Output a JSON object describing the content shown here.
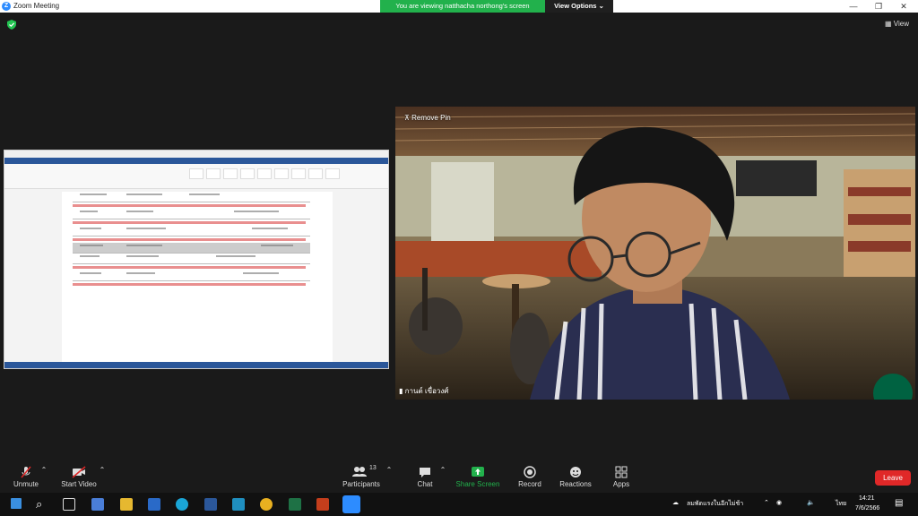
{
  "window": {
    "title": "Zoom Meeting"
  },
  "share": {
    "message": "You are viewing natthacha northong's screen",
    "options_label": "View Options"
  },
  "meeting": {
    "view_label": "View"
  },
  "video": {
    "remove_pin": "Remove Pin",
    "participant_name": "กานต์ เขื่อวงศ์"
  },
  "toolbar": {
    "unmute": "Unmute",
    "start_video": "Start Video",
    "participants": "Participants",
    "participants_count": "13",
    "chat": "Chat",
    "share_screen": "Share Screen",
    "record": "Record",
    "reactions": "Reactions",
    "apps": "Apps",
    "leave": "Leave"
  },
  "taskbar": {
    "status_text": "ลมพัดแรงในอีกไม่ช้า",
    "language": "ไทย",
    "time": "14:21",
    "date": "7/6/2566"
  },
  "colors": {
    "share_green": "#22b14c",
    "leave_red": "#e02828",
    "zoom_blue": "#2d8cff",
    "word_blue": "#2b579a"
  }
}
